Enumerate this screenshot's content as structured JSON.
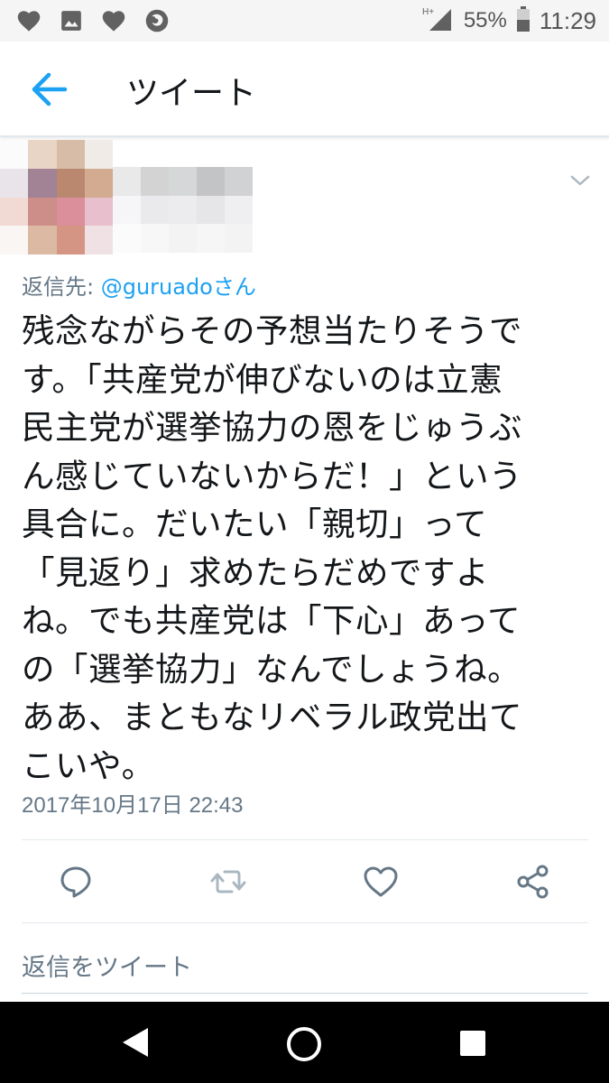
{
  "status_bar": {
    "network": "H+",
    "battery": "55%",
    "time": "11:29"
  },
  "header": {
    "title": "ツイート"
  },
  "tweet": {
    "reply_prefix": "返信先: ",
    "reply_handle": "@guruado",
    "reply_suffix": "さん",
    "text_lines": [
      "残念ながらその予想当たりそうで",
      "す。「共産党が伸びないのは立憲",
      "民主党が選挙協力の恩をじゅうぶ",
      "ん感じていないからだ！」という",
      "具合に。だいたい「親切」って",
      "「見返り」求めたらだめですよ",
      "ね。でも共産党は「下心」あって",
      "の「選挙協力」なんでしょうね。",
      "ああ、まともなリベラル政党出て",
      "こいや。"
    ],
    "timestamp": "2017年10月17日 22:43"
  },
  "compose": {
    "placeholder": "返信をツイート"
  },
  "colors": {
    "accent": "#1da1f2",
    "icon_gray": "#657786",
    "retweet_disabled": "#aab8c2"
  }
}
